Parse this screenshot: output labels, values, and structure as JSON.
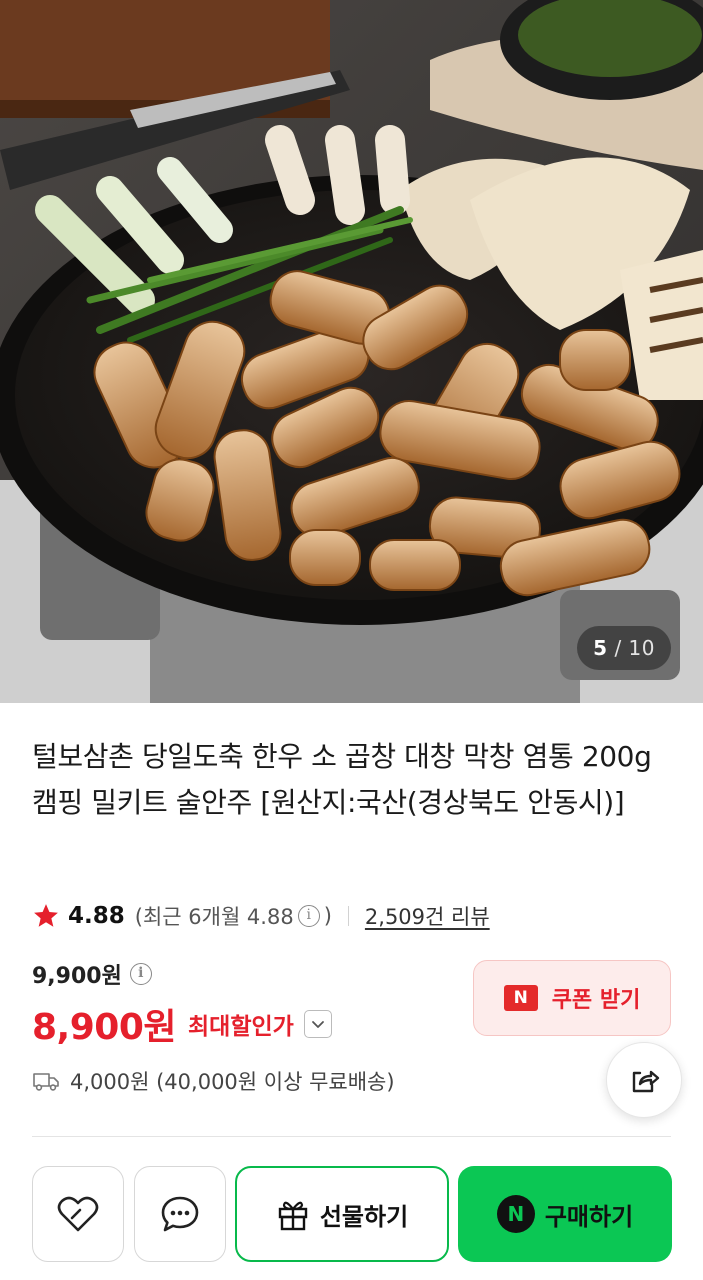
{
  "gallery": {
    "current": "5",
    "separator": "/",
    "total": "10"
  },
  "product": {
    "title": "털보삼촌 당일도축 한우 소 곱창 대창 막창 염통 200g 캠핑 밀키트 술안주 [원산지:국산(경상북도 안동시)]"
  },
  "rating": {
    "score": "4.88",
    "recent_prefix": "(최근 6개월 4.88",
    "recent_suffix": ")",
    "reviews": "2,509건 리뷰"
  },
  "price": {
    "original": "9,900원",
    "sale": "8,900원",
    "sale_label": "최대할인가"
  },
  "coupon": {
    "badge": "N",
    "label": "쿠폰 받기"
  },
  "shipping": {
    "text": "4,000원 (40,000원 이상 무료배송)"
  },
  "actions": {
    "gift": "선물하기",
    "buy_badge": "N",
    "buy": "구매하기"
  },
  "colors": {
    "accent_red": "#e5202c",
    "naver_green": "#0bc754"
  },
  "icons": [
    "star-icon",
    "info-icon",
    "chevron-down-icon",
    "truck-icon",
    "share-icon",
    "heart-icon",
    "chat-icon",
    "gift-icon"
  ]
}
